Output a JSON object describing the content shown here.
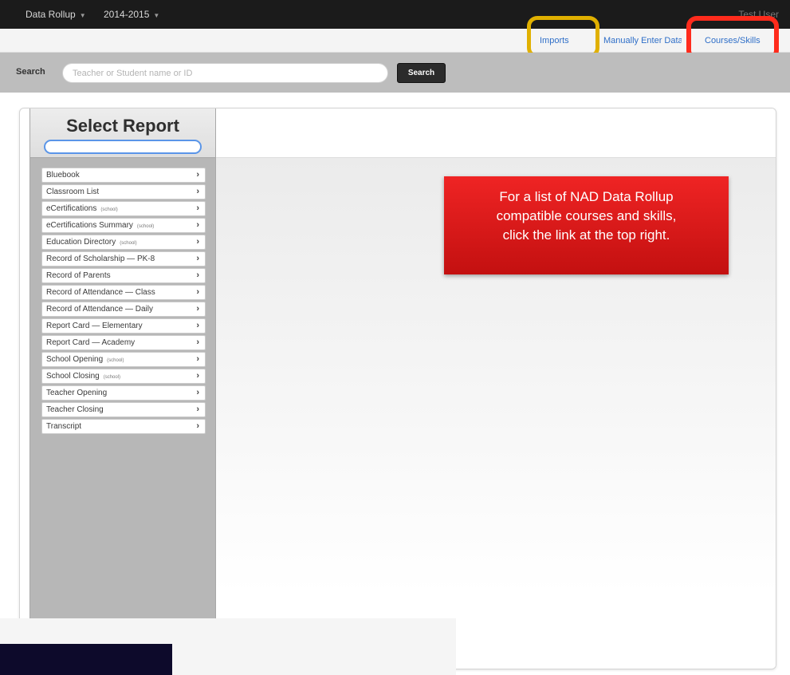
{
  "topbar": {
    "app_menu": "Data Rollup",
    "year_menu": "2014-2015",
    "user_name": "Test User"
  },
  "nav": {
    "imports": "Imports",
    "manual_entry": "Manually Enter Data",
    "courses_skills": "Courses/Skills"
  },
  "highlights": {
    "imports_color": "#e0b000",
    "courses_color": "#ff2b1c"
  },
  "search": {
    "label": "Search",
    "placeholder": "Teacher or Student name or ID",
    "button": "Search"
  },
  "sidebar": {
    "title": "Select Report",
    "filter_value": "",
    "items": [
      {
        "label": "Bluebook",
        "tag": ""
      },
      {
        "label": "Classroom List",
        "tag": ""
      },
      {
        "label": "eCertifications",
        "tag": "(school)"
      },
      {
        "label": "eCertifications Summary",
        "tag": "(school)"
      },
      {
        "label": "Education Directory",
        "tag": "(school)"
      },
      {
        "label": "Record of Scholarship — PK-8",
        "tag": ""
      },
      {
        "label": "Record of Parents",
        "tag": ""
      },
      {
        "label": "Record of Attendance — Class",
        "tag": ""
      },
      {
        "label": "Record of Attendance — Daily",
        "tag": ""
      },
      {
        "label": "Report Card — Elementary",
        "tag": ""
      },
      {
        "label": "Report Card — Academy",
        "tag": ""
      },
      {
        "label": "School Opening",
        "tag": "(school)"
      },
      {
        "label": "School Closing",
        "tag": "(school)"
      },
      {
        "label": "Teacher Opening",
        "tag": ""
      },
      {
        "label": "Teacher Closing",
        "tag": ""
      },
      {
        "label": "Transcript",
        "tag": ""
      }
    ]
  },
  "callout": {
    "line1": "For a list of NAD Data Rollup",
    "line2": "compatible courses and skills,",
    "line3": "click the link at the top right."
  }
}
